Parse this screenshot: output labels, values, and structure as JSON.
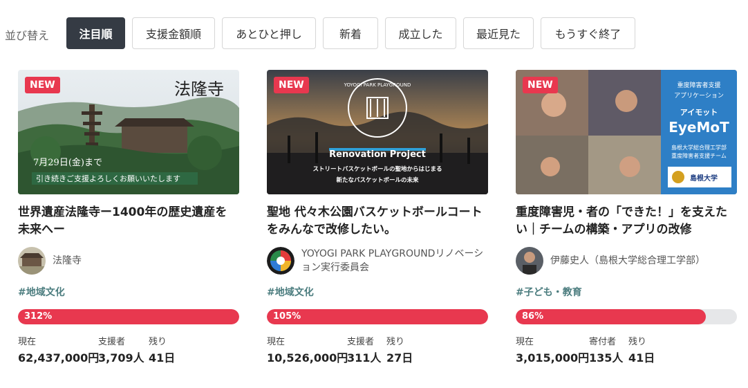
{
  "sort": {
    "label": "並び替え",
    "options": [
      "注目順",
      "支援金額順",
      "あとひと押し",
      "新着",
      "成立した",
      "最近見た",
      "もうすぐ終了"
    ],
    "active": "注目順"
  },
  "cards": [
    {
      "badge": "NEW",
      "image_text": {
        "main": "法隆寺",
        "date": "7月29日(金)まで",
        "line": "引き続きご支援よろしくお願いいたします"
      },
      "title_line1": "世界遺産法隆寺ー1400年の歴史遺産を",
      "title_line2": "未来へー",
      "owner": "法隆寺",
      "tag": "#地域文化",
      "progress_label": "312%",
      "progress": 1.0,
      "labels": {
        "current": "現在",
        "supporters": "支援者",
        "remaining": "残り"
      },
      "values": {
        "current": "62,437,000円",
        "supporters": "3,709人",
        "remaining": "41日"
      }
    },
    {
      "badge": "NEW",
      "image_text": {
        "logo": "YOYOGI PARK PLAYGROUND",
        "main": "Renovation Project",
        "line1": "ストリートバスケットボールの聖地からはじまる",
        "line2": "新たなバスケットボールの未来"
      },
      "title_line1": "聖地 代々木公園バスケットボールコート",
      "title_line2": "をみんなで改修したい。",
      "owner_line1": "YOYOGI PARK PLAYGROUNDリノベーシ",
      "owner_line2": "ョン実行委員会",
      "tag": "#地域文化",
      "progress_label": "105%",
      "progress": 1.0,
      "labels": {
        "current": "現在",
        "supporters": "支援者",
        "remaining": "残り"
      },
      "values": {
        "current": "10,526,000円",
        "supporters": "311人",
        "remaining": "27日"
      }
    },
    {
      "badge": "NEW",
      "image_text": {
        "l1": "重度障害者支援",
        "l2": "アプリケーション",
        "l3": "アイモット",
        "l4": "EyeMoT",
        "l5": "島根大学総合理工学部",
        "l6": "重度障害者支援チーム",
        "logo": "島根大学"
      },
      "title_line1": "重度障害児・者の「できた！」を支えた",
      "title_line2": "い｜チームの構築・アプリの改修",
      "owner": "伊藤史人（島根大学総合理工学部）",
      "tag": "#子ども・教育",
      "progress_label": "86%",
      "progress": 0.86,
      "labels": {
        "current": "現在",
        "supporters": "寄付者",
        "remaining": "残り"
      },
      "values": {
        "current": "3,015,000円",
        "supporters": "135人",
        "remaining": "41日"
      }
    }
  ],
  "colors": {
    "accent": "#e8384f",
    "dark": "#353b44",
    "tag": "#4c7d7f",
    "track": "#e6e7e9"
  }
}
